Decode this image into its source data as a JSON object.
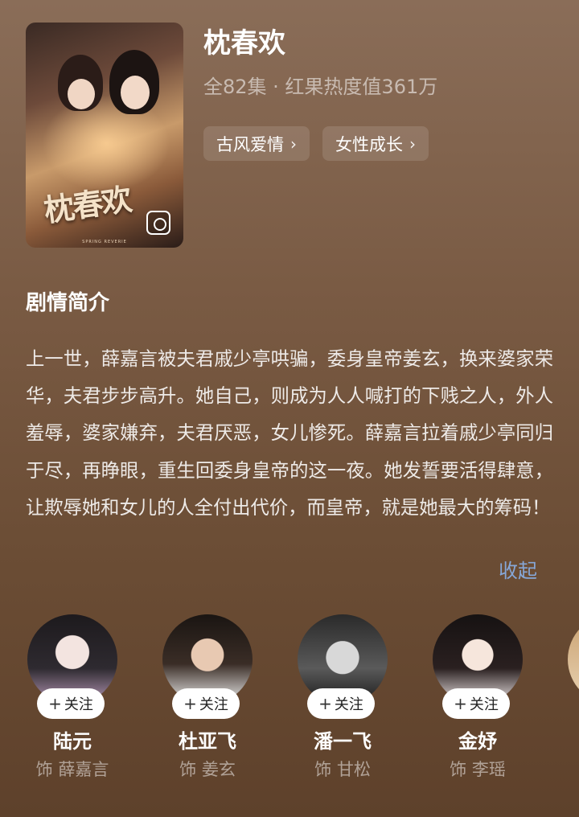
{
  "show": {
    "title": "枕春欢",
    "meta": "全82集 · 红果热度值361万",
    "tags": [
      {
        "label": "古风爱情"
      },
      {
        "label": "女性成长"
      }
    ],
    "poster_title_art": "枕春欢",
    "poster_subtitle": "SPRING REVERIE"
  },
  "synopsis": {
    "heading": "剧情简介",
    "text": "上一世，薛嘉言被夫君戚少亭哄骗，委身皇帝姜玄，换来婆家荣华，夫君步步高升。她自己，则成为人人喊打的下贱之人，外人羞辱，婆家嫌弃，夫君厌恶，女儿惨死。薛嘉言拉着戚少亭同归于尽，再睁眼，重生回委身皇帝的这一夜。她发誓要活得肆意，让欺辱她和女儿的人全付出代价，而皇帝，就是她最大的筹码！",
    "collapse_label": "收起"
  },
  "cast": {
    "follow_label": "关注",
    "members": [
      {
        "name": "陆元",
        "role": "饰 薛嘉言"
      },
      {
        "name": "杜亚飞",
        "role": "饰 姜玄"
      },
      {
        "name": "潘一飞",
        "role": "饰 甘松"
      },
      {
        "name": "金妤",
        "role": "饰 李瑶"
      },
      {
        "name": "",
        "role": ""
      }
    ]
  },
  "colors": {
    "accent_link": "#86a7d8",
    "background_top": "#8a6d58",
    "background_bottom": "#5e412b"
  }
}
